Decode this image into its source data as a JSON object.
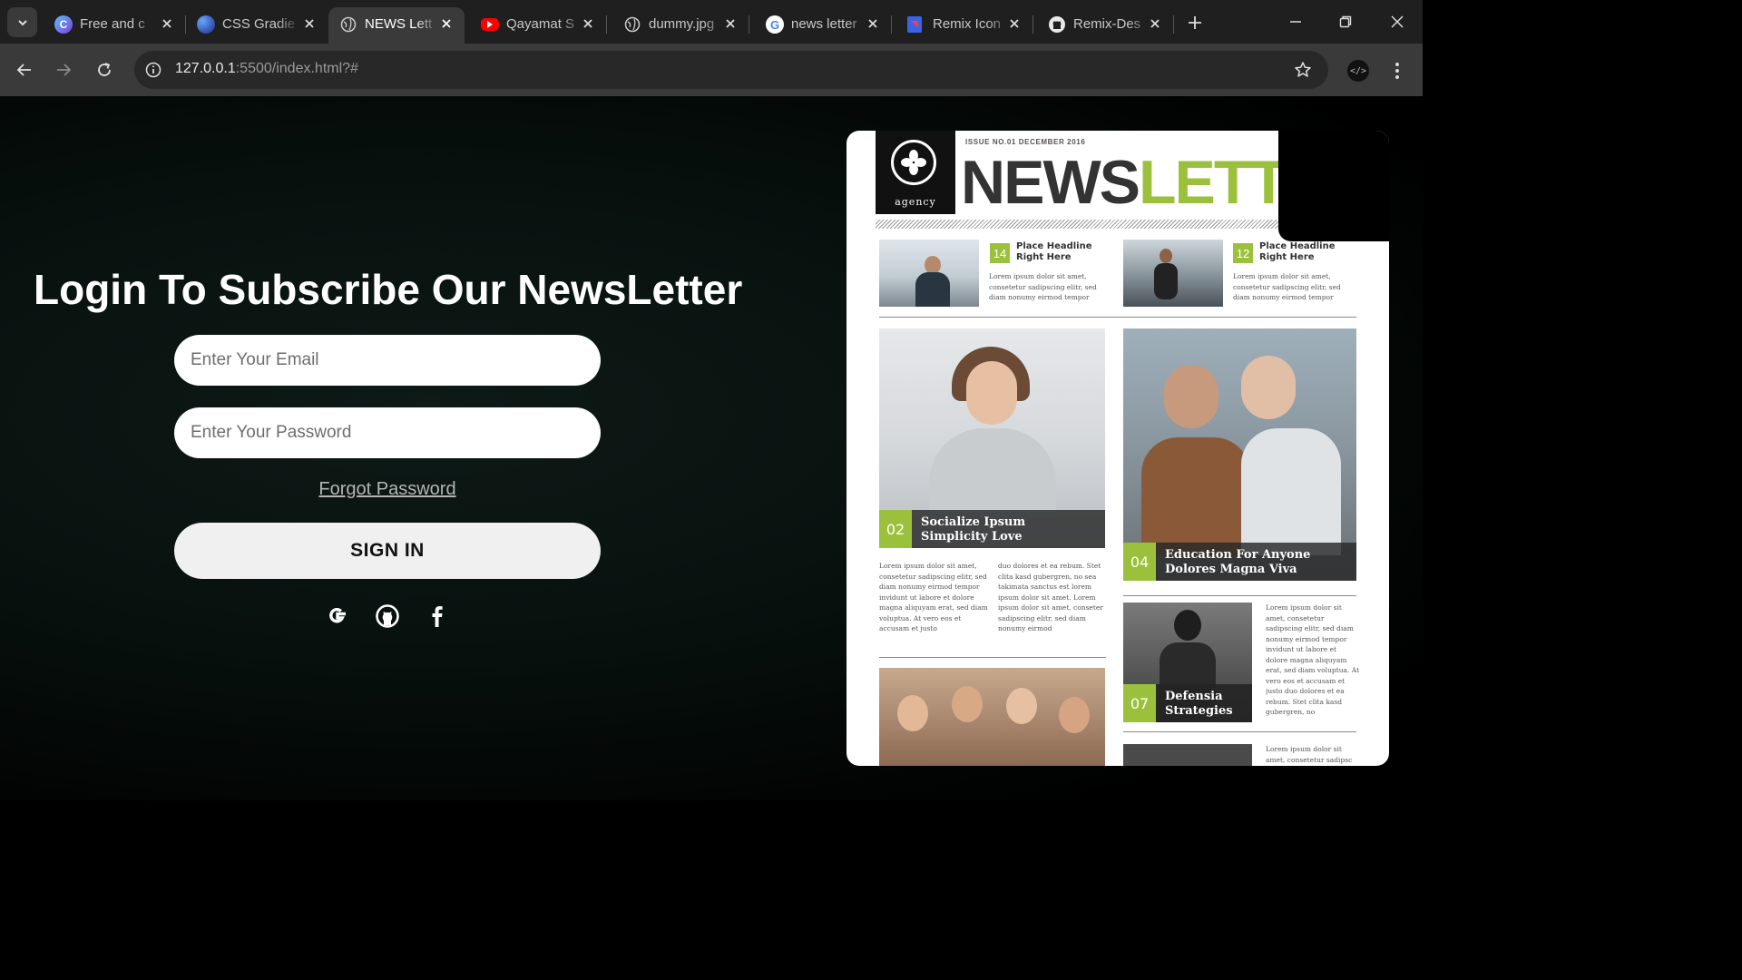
{
  "browser": {
    "tabs": [
      {
        "title": "Free and c",
        "favicon": "canva-icon",
        "active": false
      },
      {
        "title": "CSS Gradie",
        "favicon": "gradient-icon",
        "active": false
      },
      {
        "title": "NEWS Lett",
        "favicon": "globe-icon",
        "active": true
      },
      {
        "title": "Qayamat S",
        "favicon": "youtube-icon",
        "active": false
      },
      {
        "title": "dummy.jpg",
        "favicon": "globe-icon",
        "active": false
      },
      {
        "title": "news letter",
        "favicon": "google-icon",
        "active": false
      },
      {
        "title": "Remix Icon",
        "favicon": "remix-icon",
        "active": false
      },
      {
        "title": "Remix-Des",
        "favicon": "github-icon",
        "active": false
      }
    ],
    "url_host": "127.0.0.1",
    "url_rest": ":5500/index.html?#"
  },
  "page": {
    "headline": "Login To Subscribe Our NewsLetter",
    "email_placeholder": "Enter Your Email",
    "password_placeholder": "Enter Your Password",
    "forgot_label": "Forgot Password",
    "signin_label": "SIGN IN",
    "social": [
      "google-icon",
      "github-icon",
      "facebook-icon"
    ]
  },
  "newsletter": {
    "issue": "ISSUE NO.01 DECEMBER 2016",
    "logo_text": "agency",
    "mast_a": "NEWS",
    "mast_b": "LETT",
    "story1_num": "14",
    "story1_head1": "Place Headline",
    "story1_head2": "Right Here",
    "story2_num": "12",
    "story2_head1": "Place Headline",
    "story2_head2": "Right Here",
    "small_body_1": "Lorem ipsum dolor sit amet, consetetur sadipscing elitr, sed diam nonumy eirmod tempor invidunt ut",
    "feature1_num": "02",
    "feature1_line1": "Socialize Ipsum",
    "feature1_line2": "Simplicity Love",
    "feature2_num": "04",
    "feature2_line1": "Education For Anyone",
    "feature2_line2": "Dolores Magna Viva",
    "col1": "Lorem ipsum dolor sit amet, consetetur sadipscing elitr, sed diam nonumy eirmod tempor invidunt ut labore et dolore magna aliquyam erat, sed diam voluptua. At vero eos et accusam et justo",
    "col2": "duo dolores et ea rebum. Stet clita kasd gubergren, no sea takimata sanctus est lorem ipsum dolor sit amet. Lorem ipsum dolor sit amet, conseter sadipscing elitr, sed diam nonumy eirmod",
    "feature3_num": "07",
    "feature3_line1": "Defensia",
    "feature3_line2": "Strategies",
    "col3": "Lorem ipsum dolor sit amet, consetetur sadipscing elitr, sed diam nonumy eirmod tempor invidunt ut labore et dolore magna aliquyam erat, sed diam voluptua. At vero eos et accusam et justo duo dolores et ea rebum. Stet clita kasd gubergren, no",
    "col4": "Lorem ipsum dolor sit amet, consetetur sadipsc"
  },
  "colors": {
    "accent": "#9bc13c",
    "page_bg": "#07100d"
  }
}
